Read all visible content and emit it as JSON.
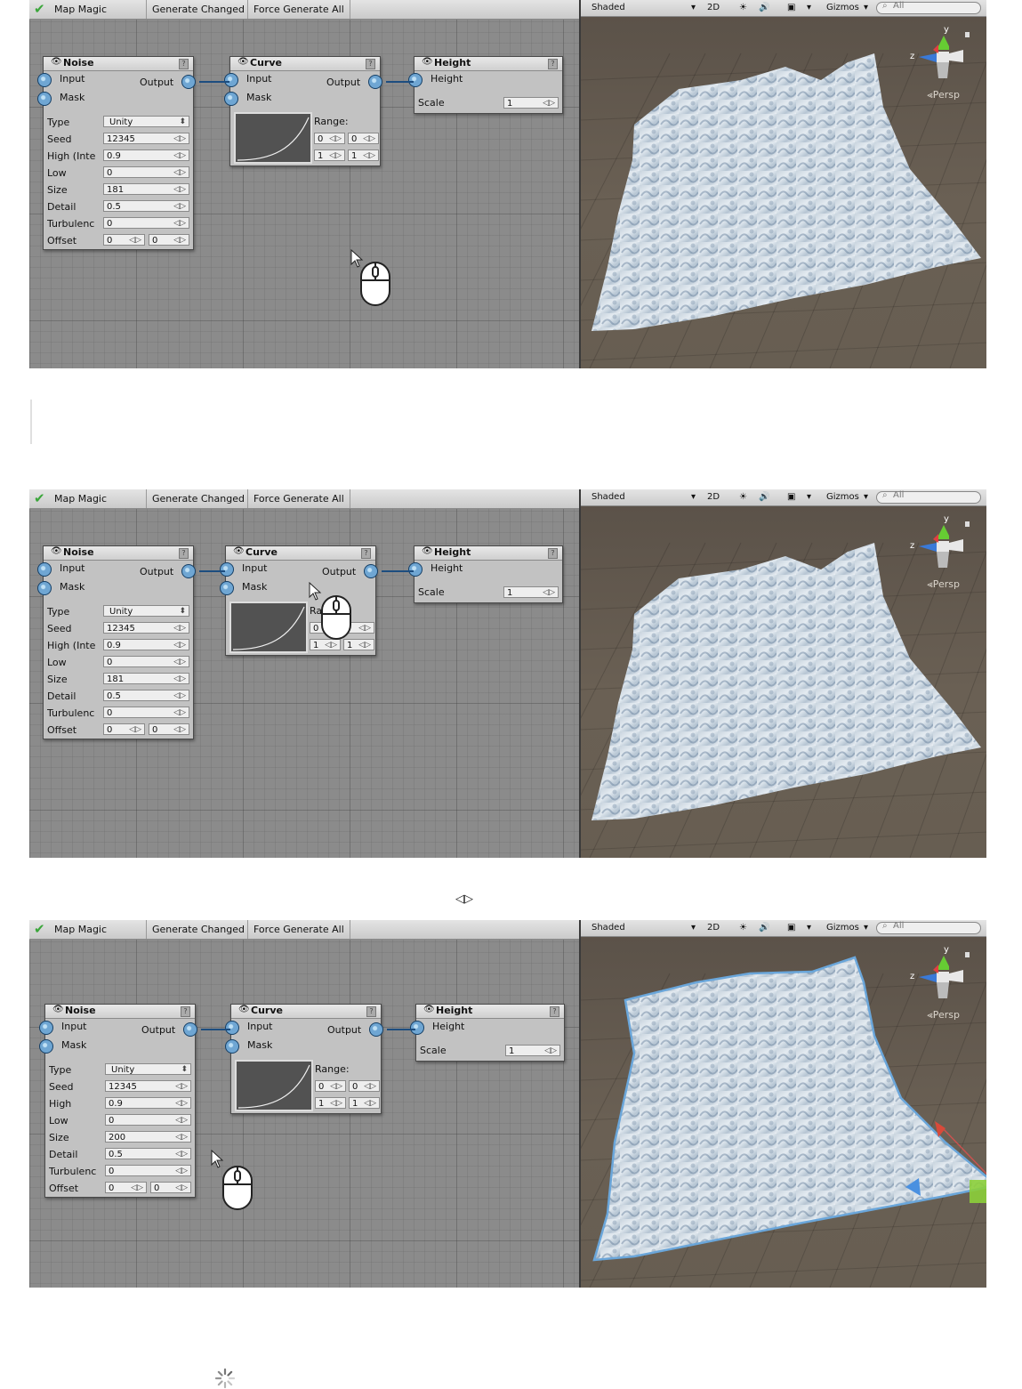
{
  "toolbar": {
    "check_icon": "check-icon",
    "title": "Map Magic",
    "generate_changed": "Generate Changed",
    "force_generate_all": "Force Generate All"
  },
  "scene_toolbar": {
    "shading": "Shaded",
    "mode_2d": "2D",
    "gizmos": "Gizmos",
    "search_placeholder": "All",
    "persp": "Persp"
  },
  "colors": {
    "graph_bg": "#8b8b8b",
    "scene_bg": "#675e52",
    "port": "#6fa6d3",
    "wire": "#1d4d7f",
    "terrain_ice": "#dfe7ef"
  },
  "frames": [
    {
      "noise": {
        "title": "Noise",
        "input": "Input",
        "mask": "Mask",
        "output": "Output",
        "fields": [
          {
            "k": "Type",
            "v": "Unity"
          },
          {
            "k": "Seed",
            "v": "12345"
          },
          {
            "k": "High (Inte",
            "v": "0.9"
          },
          {
            "k": "Low",
            "v": "0"
          },
          {
            "k": "Size",
            "v": "181"
          },
          {
            "k": "Detail",
            "v": "0.5"
          },
          {
            "k": "Turbulenc",
            "v": "0"
          },
          {
            "k": "Offset",
            "v": "0",
            "v2": "0"
          }
        ]
      },
      "curve": {
        "title": "Curve",
        "input": "Input",
        "mask": "Mask",
        "output": "Output",
        "range": "Range:",
        "r1a": "0",
        "r1b": "0",
        "r2a": "1",
        "r2b": "1"
      },
      "height": {
        "title": "Height",
        "input": "Height",
        "scale_label": "Scale",
        "scale": "1"
      }
    },
    {
      "noise": {
        "title": "Noise",
        "input": "Input",
        "mask": "Mask",
        "output": "Output",
        "fields": [
          {
            "k": "Type",
            "v": "Unity"
          },
          {
            "k": "Seed",
            "v": "12345"
          },
          {
            "k": "High (Inte",
            "v": "0.9"
          },
          {
            "k": "Low",
            "v": "0"
          },
          {
            "k": "Size",
            "v": "181"
          },
          {
            "k": "Detail",
            "v": "0.5"
          },
          {
            "k": "Turbulenc",
            "v": "0"
          },
          {
            "k": "Offset",
            "v": "0",
            "v2": "0"
          }
        ]
      },
      "curve": {
        "title": "Curve",
        "input": "Input",
        "mask": "Mask",
        "output": "Output",
        "range": "Ra",
        "r1a": "0",
        "r1b": "",
        "r2a": "1",
        "r2b": "1"
      },
      "height": {
        "title": "Height",
        "input": "Height",
        "scale_label": "Scale",
        "scale": "1"
      }
    },
    {
      "noise": {
        "title": "Noise",
        "input": "Input",
        "mask": "Mask",
        "output": "Output",
        "fields": [
          {
            "k": "Type",
            "v": "Unity"
          },
          {
            "k": "Seed",
            "v": "12345"
          },
          {
            "k": "High",
            "v": "0.9"
          },
          {
            "k": "Low",
            "v": "0"
          },
          {
            "k": "Size",
            "v": "200"
          },
          {
            "k": "Detail",
            "v": "0.5"
          },
          {
            "k": "Turbulenc",
            "v": "0"
          },
          {
            "k": "Offset",
            "v": "0",
            "v2": "0"
          }
        ]
      },
      "curve": {
        "title": "Curve",
        "input": "Input",
        "mask": "Mask",
        "output": "Output",
        "range": "Range:",
        "r1a": "0",
        "r1b": "0",
        "r2a": "1",
        "r2b": "1"
      },
      "height": {
        "title": "Height",
        "input": "Height",
        "scale_label": "Scale",
        "scale": "1"
      }
    }
  ],
  "icons": {
    "mid": "playback-toggle-icon",
    "bottom": "loading-spinner-icon"
  }
}
